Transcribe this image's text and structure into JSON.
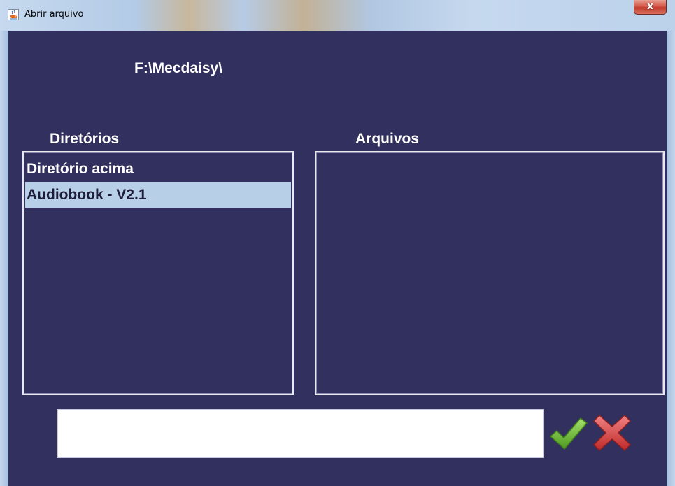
{
  "window": {
    "title": "Abrir arquivo",
    "close_glyph": "x",
    "app_icon": "java-cup-icon"
  },
  "dialog": {
    "current_path": "F:\\Mecdaisy\\",
    "directories_label": "Diretórios",
    "files_label": "Arquivos",
    "directories": [
      "Diretório acima",
      "Audiobook - V2.1"
    ],
    "selected_directory": "Audiobook - V2.1",
    "files": [],
    "filename": {
      "value": "",
      "placeholder": ""
    },
    "buttons": {
      "ok_icon": "green-check-icon",
      "cancel_icon": "red-x-icon"
    }
  },
  "colors": {
    "background": "#31305f",
    "selection": "#b8cfe8",
    "text": "#ffffff",
    "ok": "#6fc03a",
    "cancel": "#d33c3c"
  }
}
